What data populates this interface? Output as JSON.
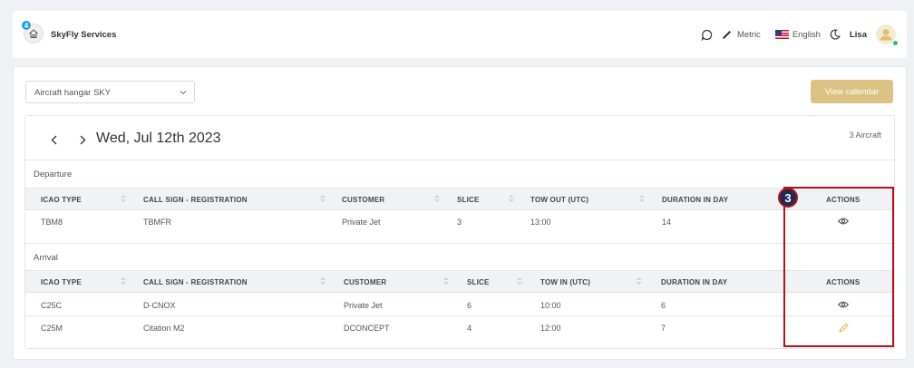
{
  "header": {
    "brand": "SkyFly Services",
    "notification_count": "4",
    "units": "Metric",
    "language": "English",
    "user": "Lisa"
  },
  "toolbar": {
    "hangar_select_value": "Aircraft hangar SKY",
    "view_calendar_label": "View calendar"
  },
  "schedule": {
    "date": "Wed, Jul 12th 2023",
    "aircraft_count": "3 Aircraft",
    "departure": {
      "label": "Departure",
      "columns": [
        "ICAO TYPE",
        "CALL SIGN - REGISTRATION",
        "CUSTOMER",
        "SLICE",
        "TOW OUT (UTC)",
        "DURATION IN DAY",
        "ACTIONS"
      ],
      "rows": [
        {
          "icao": "TBM8",
          "callsign": "TBMFR",
          "customer": "Private Jet",
          "slice": "3",
          "tow": "13:00",
          "duration": "14",
          "action": "view"
        }
      ]
    },
    "arrival": {
      "label": "Arrival",
      "columns": [
        "ICAO TYPE",
        "CALL SIGN - REGISTRATION",
        "CUSTOMER",
        "SLICE",
        "TOW IN (UTC)",
        "DURATION IN DAY",
        "ACTIONS"
      ],
      "rows": [
        {
          "icao": "C25C",
          "callsign": "D-CNOX",
          "customer": "Private Jet",
          "slice": "6",
          "tow": "10:00",
          "duration": "6",
          "action": "view"
        },
        {
          "icao": "C25M",
          "callsign": "Citation M2",
          "customer": "DCONCEPT",
          "slice": "4",
          "tow": "12:00",
          "duration": "7",
          "action": "edit"
        }
      ]
    }
  },
  "annotation": {
    "step_number": "3",
    "color": "#b4121c"
  },
  "colors": {
    "accent_gold": "#dcc282",
    "edit_icon": "#e8b04a",
    "badge_blue": "#1fa0e8",
    "online_green": "#2ec25f"
  }
}
